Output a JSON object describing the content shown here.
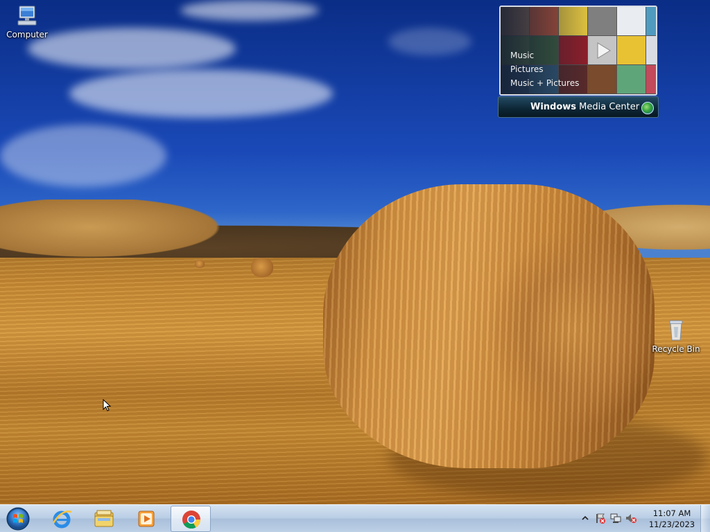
{
  "desktop": {
    "icons": [
      {
        "label": "Computer",
        "icon": "computer-icon"
      },
      {
        "label": "Recycle Bin",
        "icon": "recycle-bin-icon"
      }
    ]
  },
  "gadget": {
    "menu": [
      "Music",
      "Pictures",
      "Music + Pictures"
    ],
    "brand_bold": "Windows",
    "brand_rest": " Media Center"
  },
  "taskbar": {
    "pinned": [
      {
        "name": "Internet Explorer",
        "icon": "internet-explorer-icon"
      },
      {
        "name": "Windows Explorer",
        "icon": "file-explorer-icon"
      },
      {
        "name": "Windows Media Player",
        "icon": "media-player-icon"
      },
      {
        "name": "Google Chrome",
        "icon": "chrome-icon",
        "active": true
      }
    ],
    "tray": {
      "icons": [
        "show-hidden-icons-chevron",
        "action-center-flag-icon",
        "network-icon",
        "volume-muted-icon"
      ],
      "time": "11:07 AM",
      "date": "11/23/2023"
    }
  },
  "colors": {
    "taskbar": "#b9cde4",
    "sky": "#1a49b7",
    "field": "#c98c35"
  }
}
